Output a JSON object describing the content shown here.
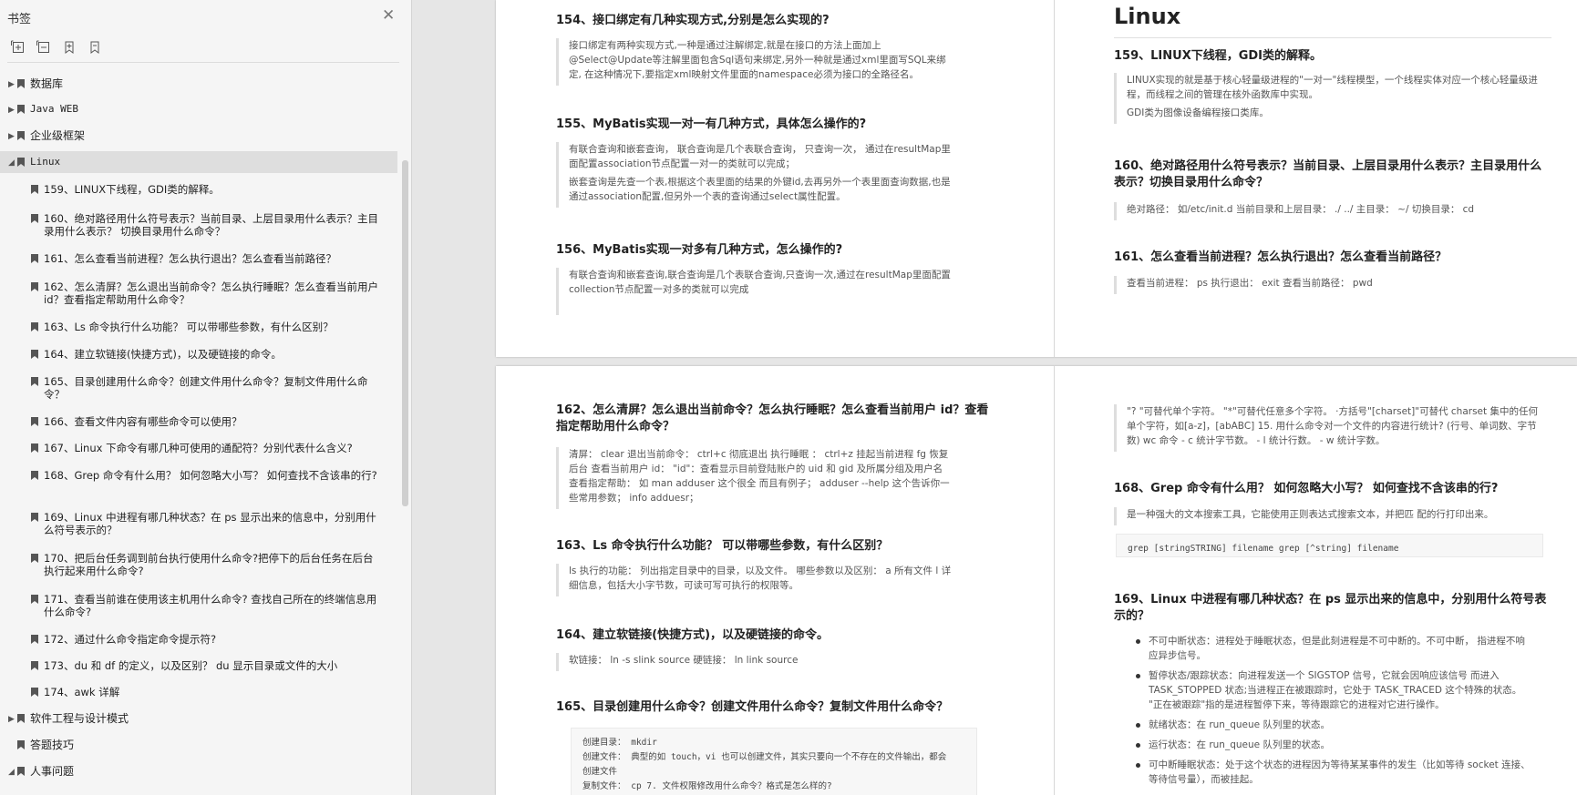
{
  "sidebar": {
    "title": "书签",
    "close_glyph": "✕",
    "toolbar": [
      "expand-all-icon",
      "collapse-all-icon",
      "add-bookmark-icon",
      "bookmark-outline-icon"
    ],
    "top_items": [
      {
        "label": "数据库",
        "expanded": false
      },
      {
        "label": "Java WEB",
        "expanded": false
      },
      {
        "label": "企业级框架",
        "expanded": false
      },
      {
        "label": "Linux",
        "expanded": true,
        "selected": true
      }
    ],
    "linux_children": [
      "159、LINUX下线程，GDI类的解释。",
      "160、绝对路径用什么符号表示？当前目录、上层目录用什么表示？主目录用什么表示？ 切换目录用什么命令？",
      "161、怎么查看当前进程？怎么执行退出？怎么查看当前路径？",
      "162、怎么清屏？怎么退出当前命令？怎么执行睡眠？怎么查看当前用户 id？查看指定帮助用什么命令？",
      "163、Ls 命令执行什么功能？ 可以带哪些参数，有什么区别？",
      "164、建立软链接(快捷方式)，以及硬链接的命令。",
      "165、目录创建用什么命令？创建文件用什么命令？复制文件用什么命令？",
      "166、查看文件内容有哪些命令可以使用？",
      "167、Linux 下命令有哪几种可使用的通配符？分别代表什么含义?",
      "168、Grep 命令有什么用？ 如何忽略大小写？ 如何查找不含该串的行?",
      "169、Linux 中进程有哪几种状态？在 ps 显示出来的信息中，分别用什么符号表示的？",
      "170、把后台任务调到前台执行使用什么命令?把停下的后台任务在后台执行起来用什么命令?",
      "171、查看当前谁在使用该主机用什么命令? 查找自己所在的终端信息用什么命令?",
      "172、通过什么命令指定命令提示符?",
      "173、du 和 df 的定义，以及区别？ du 显示目录或文件的大小",
      "174、awk 详解"
    ],
    "bottom_items": [
      {
        "label": "软件工程与设计模式",
        "expanded": false,
        "twisty": true
      },
      {
        "label": "答题技巧",
        "twisty": false
      },
      {
        "label": "人事问题",
        "expanded": true,
        "twisty": true
      }
    ]
  },
  "page1_left": {
    "q154": "154、接口绑定有几种实现方式,分别是怎么实现的?",
    "a154": "接口绑定有两种实现方式,一种是通过注解绑定,就是在接口的方法上面加上@Select@Update等注解里面包含Sql语句来绑定,另外一种就是通过xml里面写SQL来绑定, 在这种情况下,要指定xml映射文件里面的namespace必须为接口的全路径名。",
    "q155": "155、MyBatis实现一对一有几种方式，具体怎么操作的?",
    "a155_1": "有联合查询和嵌套查询， 联合查询是几个表联合查询， 只查询一次， 通过在resultMap里面配置association节点配置一对一的类就可以完成；",
    "a155_2": "嵌套查询是先查一个表,根据这个表里面的结果的外键id,去再另外一个表里面查询数据,也是通过association配置,但另外一个表的查询通过select属性配置。",
    "q156": "156、MyBatis实现一对多有几种方式，怎么操作的?",
    "a156": "有联合查询和嵌套查询,联合查询是几个表联合查询,只查询一次,通过在resultMap里面配置collection节点配置一对多的类就可以完成"
  },
  "page1_right": {
    "heading": "Linux",
    "q159": "159、LINUX下线程，GDI类的解释。",
    "a159_1": "LINUX实现的就是基于核心轻量级进程的\"一对一\"线程模型，一个线程实体对应一个核心轻量级进程，而线程之间的管理在核外函数库中实现。",
    "a159_2": "GDI类为图像设备编程接口类库。",
    "q160": "160、绝对路径用什么符号表示？当前目录、上层目录用什么表示？主目录用什么表示？切换目录用什么命令？",
    "a160": "绝对路径： 如/etc/init.d 当前目录和上层目录： ./ ../ 主目录： ~/ 切换目录： cd",
    "q161": "161、怎么查看当前进程？怎么执行退出？怎么查看当前路径？",
    "a161": "查看当前进程： ps 执行退出： exit 查看当前路径： pwd"
  },
  "page2_left": {
    "q162": "162、怎么清屏？怎么退出当前命令？怎么执行睡眠？怎么查看当前用户 id？查看指定帮助用什么命令？",
    "a162": "清屏： clear 退出当前命令： ctrl+c 彻底退出 执行睡眠 ： ctrl+z 挂起当前进程 fg 恢复后台 查看当前用户 id： \"id\"：查看显示目前登陆账户的 uid 和 gid 及所属分组及用户名 查看指定帮助： 如 man adduser 这个很全 而且有例子； adduser --help 这个告诉你一些常用参数； info adduesr；",
    "q163": "163、Ls 命令执行什么功能？ 可以带哪些参数，有什么区别？",
    "a163": "ls 执行的功能： 列出指定目录中的目录，以及文件。 哪些参数以及区别： a 所有文件 l 详细信息，包括大小字节数，可读可写可执行的权限等。",
    "q164": "164、建立软链接(快捷方式)，以及硬链接的命令。",
    "a164": "软链接： ln -s slink source 硬链接： ln link source",
    "q165": "165、目录创建用什么命令？创建文件用什么命令？复制文件用什么命令？",
    "code165": [
      "创建目录： mkdir",
      "创建文件： 典型的如 touch，vi 也可以创建文件，其实只要向一个不存在的文件输出，都会",
      "创建文件",
      "复制文件： cp 7. 文件权限修改用什么命令？格式是怎么样的?"
    ]
  },
  "page2_right": {
    "a167": "\"? \"可替代单个字符。 \"*\"可替代任意多个字符。 ·方括号\"[charset]\"可替代 charset 集中的任何单个字符，如[a-z]，[abABC] 15. 用什么命令对一个文件的内容进行统计? (行号、单词数、字节数) wc 命令 - c 统计字节数。 - l 统计行数。 - w 统计字数。",
    "q168": "168、Grep 命令有什么用？ 如何忽略大小写？ 如何查找不含该串的行?",
    "a168": "是一种强大的文本搜索工具，它能使用正则表达式搜索文本，并把匹 配的行打印出来。",
    "code168": "grep [stringSTRING] filename grep [^string] filename",
    "q169": "169、Linux 中进程有哪几种状态？在 ps 显示出来的信息中，分别用什么符号表示的？",
    "bullets169": [
      "不可中断状态：进程处于睡眠状态，但是此刻进程是不可中断的。不可中断， 指进程不响应异步信号。",
      "暂停状态/跟踪状态：向进程发送一个 SIGSTOP 信号，它就会因响应该信号 而进入 TASK_STOPPED 状态;当进程正在被跟踪时，它处于 TASK_TRACED 这个特殊的状态。 \"正在被跟踪\"指的是进程暂停下来，等待跟踪它的进程对它进行操作。",
      "就绪状态：在 run_queue 队列里的状态。",
      "运行状态：在 run_queue 队列里的状态。",
      "可中断睡眠状态：处于这个状态的进程因为等待某某事件的发生（比如等待 socket 连接、等待信号量），而被挂起。"
    ]
  }
}
